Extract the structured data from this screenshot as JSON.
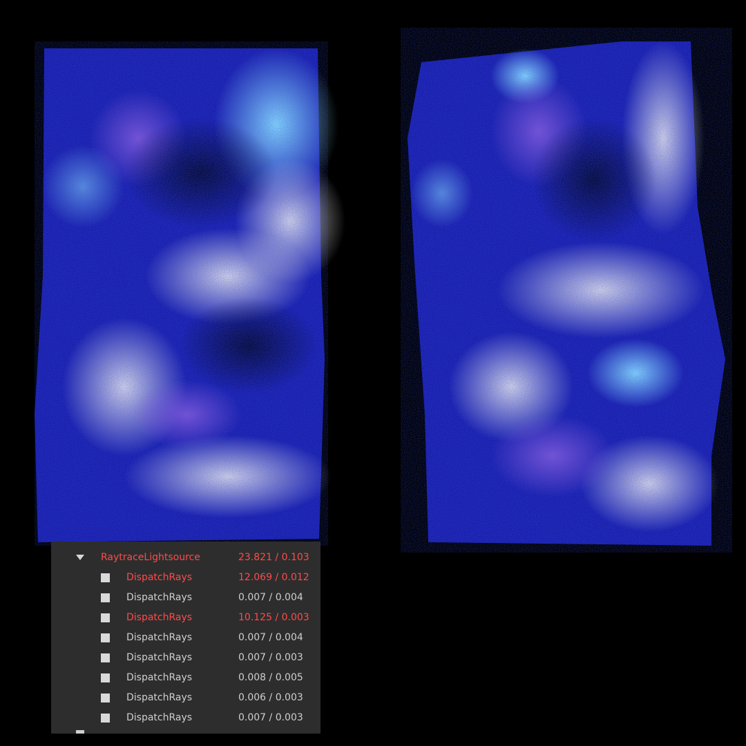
{
  "profiler": {
    "parent": {
      "label": "RaytraceLightsource",
      "value": "23.821 / 0.103",
      "hot": true,
      "expanded": true
    },
    "children": [
      {
        "label": "DispatchRays",
        "value": "12.069 / 0.012",
        "hot": true
      },
      {
        "label": "DispatchRays",
        "value": "0.007 / 0.004",
        "hot": false
      },
      {
        "label": "DispatchRays",
        "value": "10.125 / 0.003",
        "hot": true
      },
      {
        "label": "DispatchRays",
        "value": "0.007 / 0.004",
        "hot": false
      },
      {
        "label": "DispatchRays",
        "value": "0.007 / 0.003",
        "hot": false
      },
      {
        "label": "DispatchRays",
        "value": "0.008 / 0.005",
        "hot": false
      },
      {
        "label": "DispatchRays",
        "value": "0.006 / 0.003",
        "hot": false
      },
      {
        "label": "DispatchRays",
        "value": "0.007 / 0.003",
        "hot": false
      }
    ],
    "colors": {
      "hot": "#ff4b4b",
      "normal": "#cfcfcf",
      "panel_bg": "#2d2d2d"
    }
  }
}
